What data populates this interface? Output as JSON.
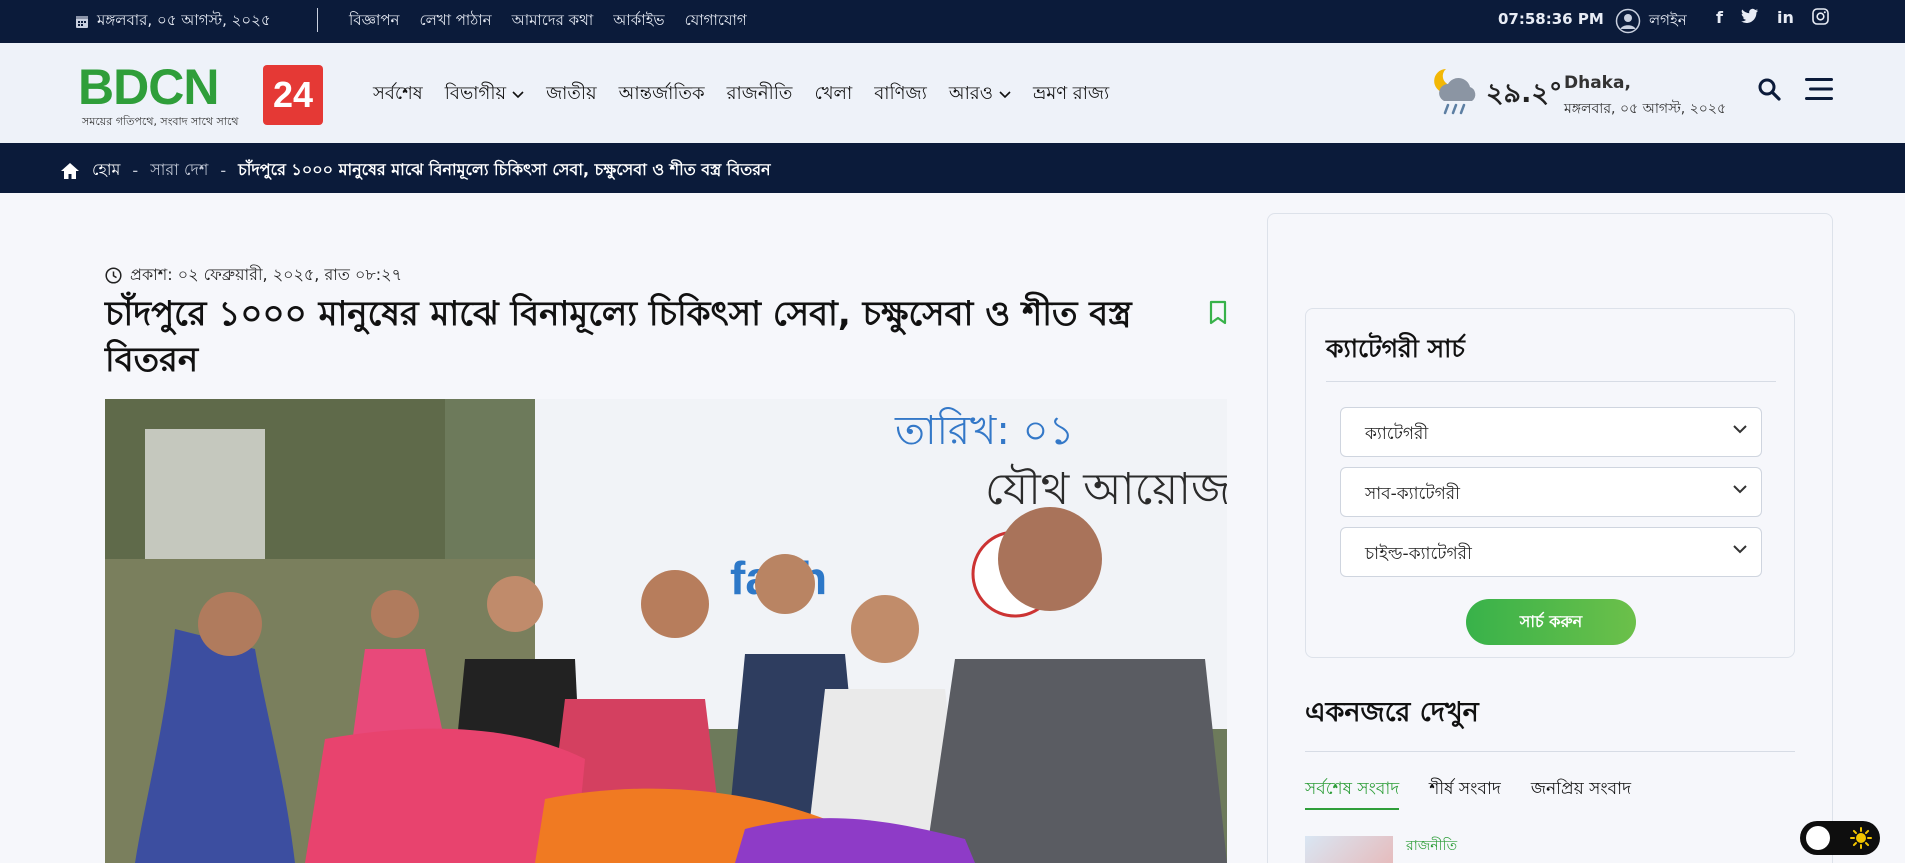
{
  "topbar": {
    "date": "মঙ্গলবার, ০৫ আগস্ট, ২০২৫",
    "links": [
      "বিজ্ঞাপন",
      "লেখা পাঠান",
      "আমাদের কথা",
      "আর্কাইভ",
      "যোগাযোগ"
    ],
    "time": "07:58:36 PM",
    "login": "লগইন",
    "social": [
      "facebook-icon",
      "twitter-icon",
      "linkedin-icon",
      "instagram-icon"
    ]
  },
  "logo": {
    "brand": "BDCN",
    "badge": "24",
    "tagline": "সময়ের গতিপথে, সংবাদ সাথে সাথে"
  },
  "nav": [
    "সর্বশেষ",
    "বিভাগীয়",
    "জাতীয়",
    "আন্তর্জাতিক",
    "রাজনীতি",
    "খেলা",
    "বাণিজ্য",
    "আরও",
    "ভ্রমণ রাজ্য"
  ],
  "weather": {
    "temp": "২৯.২°",
    "city": "Dhaka,",
    "date": "মঙ্গলবার, ০৫ আগস্ট, ২০২৫"
  },
  "breadcrumb": {
    "home": "হোম",
    "section": "সারা দেশ",
    "current": "চাঁদপুরে ১০০০ মানুষের মাঝে বিনামূল্যে চিকিৎসা সেবা, চক্ষুসেবা ও শীত বস্ত্র বিতরন"
  },
  "article": {
    "published": "প্রকাশ: ০২ ফেব্রুয়ারী, ২০২৫, রাত ০৮:২৭",
    "title": "চাঁদপুরে ১০০০ মানুষের মাঝে বিনামূল্যে চিকিৎসা সেবা, চক্ষুসেবা ও শীত বস্ত্র বিতরন"
  },
  "sidebar": {
    "category_search_title": "ক্যাটেগরী সার্চ",
    "category_placeholder": "ক্যাটেগরী",
    "subcategory_placeholder": "সাব-ক্যাটেগরী",
    "childcategory_placeholder": "চাইল্ড-ক্যাটেগরী",
    "search_button": "সার্চ করুন",
    "glance_title": "একনজরে দেখুন",
    "tabs": [
      "সর্বশেষ সংবাদ",
      "শীর্ষ সংবাদ",
      "জনপ্রিয় সংবাদ"
    ],
    "first_item_category": "রাজনীতি"
  },
  "colors": {
    "navy": "#0b1b3a",
    "green": "#2f9e3a",
    "red": "#e53935"
  }
}
